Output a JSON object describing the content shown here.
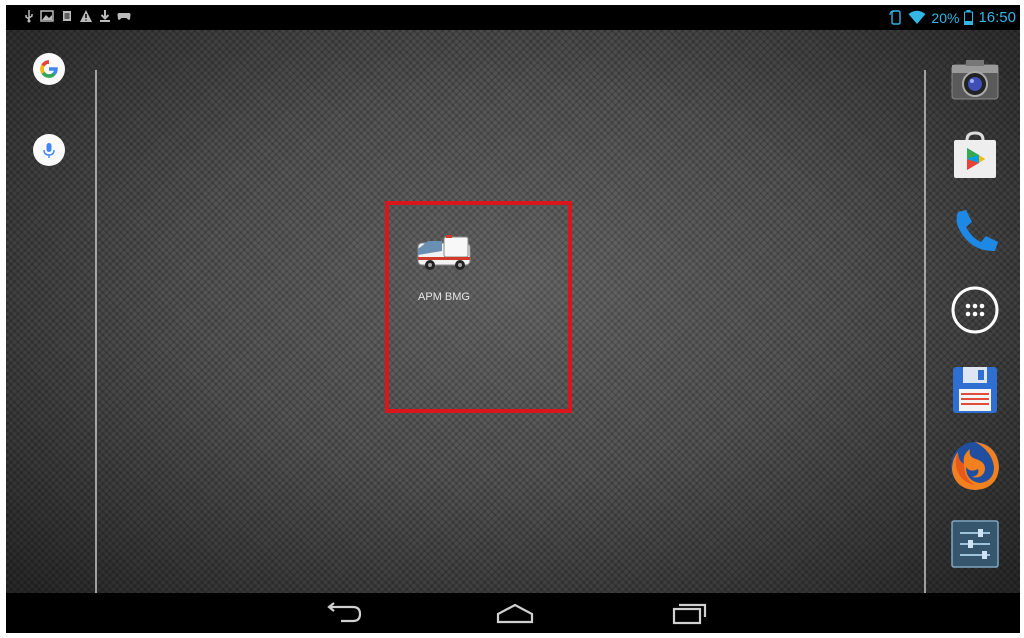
{
  "status_bar": {
    "left_icons": [
      "usb-icon",
      "image-icon",
      "notes-icon",
      "warning-icon",
      "download-icon",
      "gamepad-icon"
    ],
    "right_icons": [
      "rotate-icon",
      "wifi-icon",
      "battery-icon"
    ],
    "battery_percent": "20%",
    "time": "16:50"
  },
  "left_rail": {
    "items": [
      {
        "name": "google-search-button",
        "icon": "google-icon"
      },
      {
        "name": "voice-search-button",
        "icon": "microphone-icon"
      }
    ]
  },
  "home": {
    "app_shortcut_label": "APM BMG",
    "app_shortcut_icon": "ambulance-icon",
    "highlight_color": "#d9161c"
  },
  "dock": {
    "items": [
      {
        "name": "camera-app",
        "icon": "camera-icon"
      },
      {
        "name": "play-store-app",
        "icon": "play-store-icon"
      },
      {
        "name": "phone-app",
        "icon": "phone-icon"
      },
      {
        "name": "all-apps-button",
        "icon": "app-drawer-icon"
      },
      {
        "name": "save-app",
        "icon": "floppy-disk-icon"
      },
      {
        "name": "firefox-app",
        "icon": "firefox-icon"
      },
      {
        "name": "settings-app",
        "icon": "settings-sliders-icon"
      }
    ]
  },
  "nav_bar": {
    "buttons": [
      "back-icon",
      "home-icon",
      "recents-icon"
    ]
  },
  "colors": {
    "status_accent": "#33b5e5",
    "bars": "#000000"
  }
}
